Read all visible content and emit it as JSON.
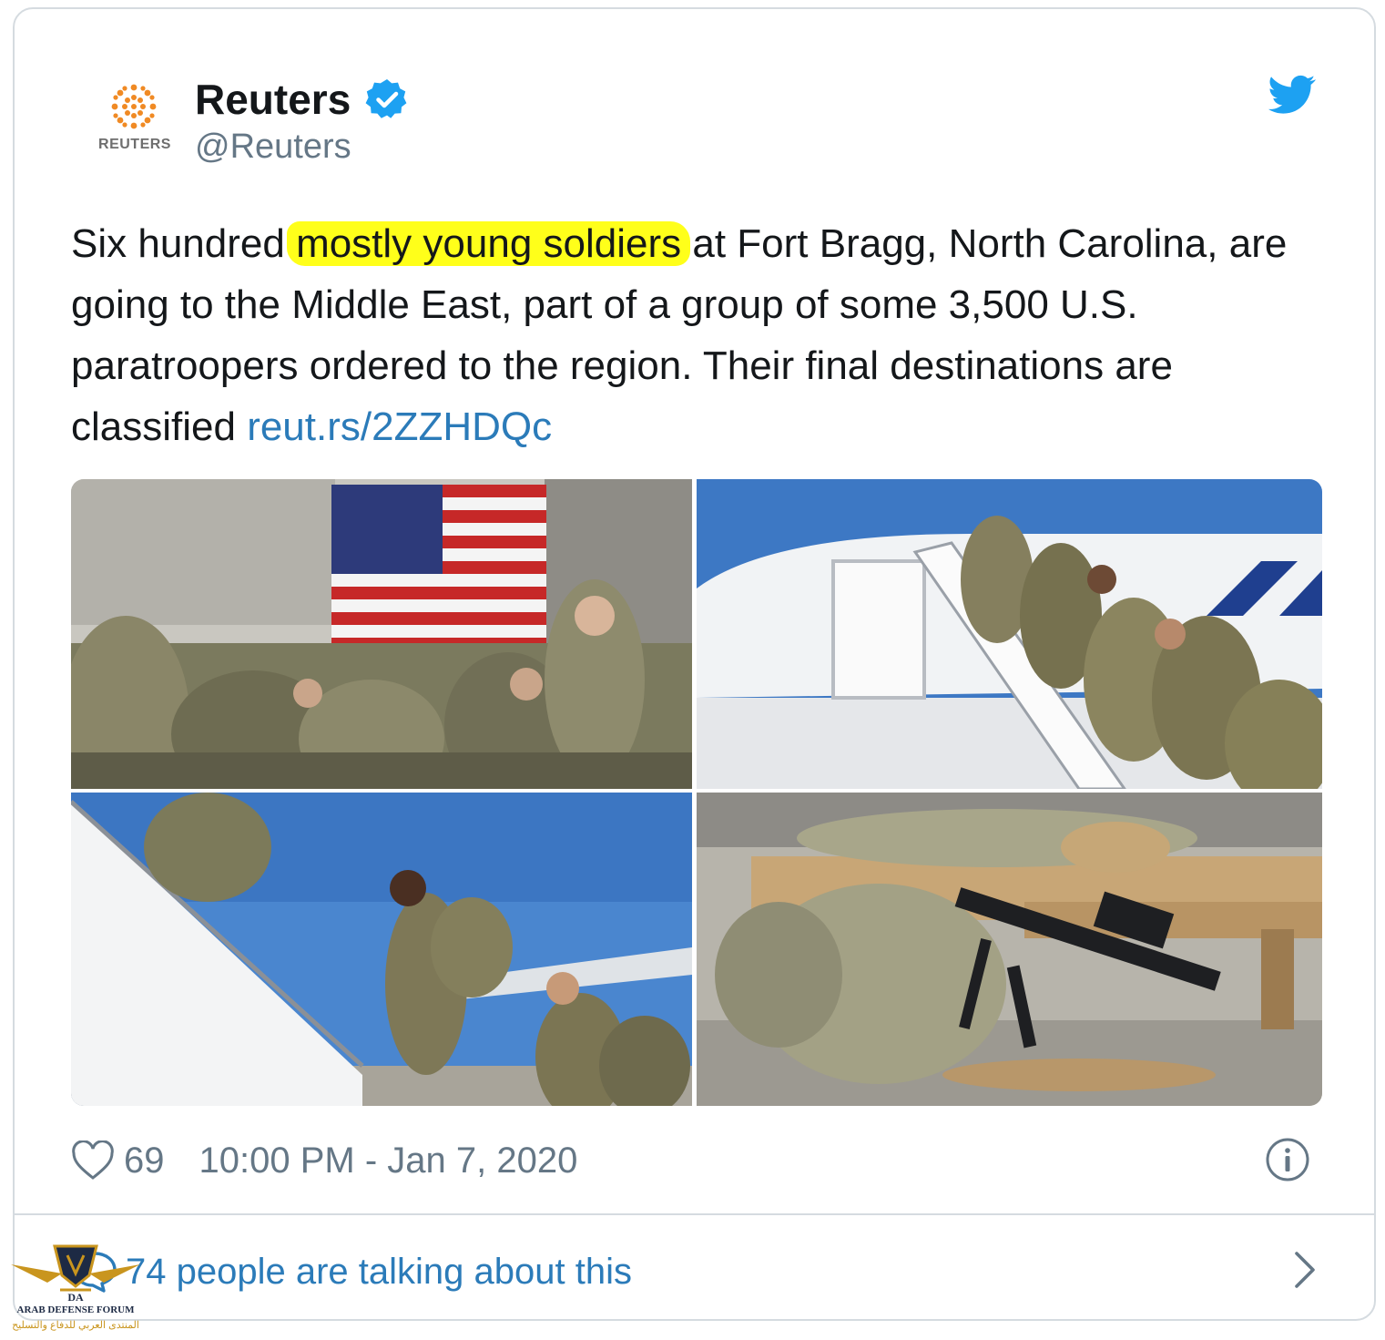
{
  "tweet": {
    "account": {
      "display_name": "Reuters",
      "handle": "@Reuters",
      "avatar_wordmark": "REUTERS",
      "verified": true
    },
    "text": {
      "before_highlight": "Six hundred ",
      "highlight": "mostly young soldiers",
      "after_highlight": " at Fort Bragg, North Carolina, are going to the Middle East, part of a group of some 3,500 U.S. paratroopers ordered to the region. Their final destinations are classified ",
      "link": "reut.rs/2ZZHDQc"
    },
    "media": {
      "photos": [
        {
          "subject": "Soldiers seated in a hangar in front of a U.S. flag"
        },
        {
          "subject": "Soldiers climbing aircraft stairs"
        },
        {
          "subject": "Soldiers with backpacks boarding a plane"
        },
        {
          "subject": "Soldier resting on bench beside rifle and gear"
        }
      ]
    },
    "likes": "69",
    "timestamp": "10:00 PM - Jan 7, 2020",
    "conversation": "74 people are talking about this"
  },
  "watermark": {
    "title": "ARAB DEFENSE FORUM",
    "arabic": "المنتدى العربي للدفاع والتسليح"
  },
  "colors": {
    "link": "#2b7bb9",
    "secondary_text": "#657786",
    "twitter_blue": "#1da1f2",
    "highlight": "#ffff1a",
    "reuters_orange": "#f08a24"
  }
}
